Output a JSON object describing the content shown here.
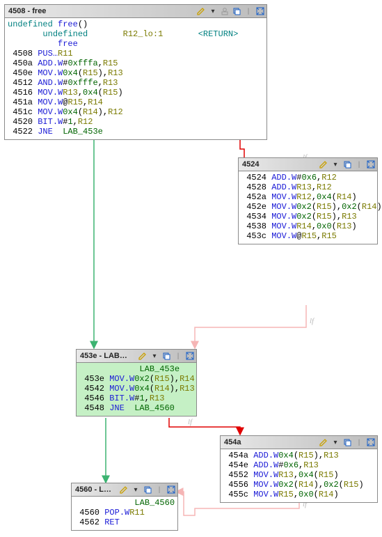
{
  "blocks": {
    "b4508": {
      "title": "4508 - free",
      "sig_line1": {
        "type": "undefined",
        "name": "free",
        "params": "()"
      },
      "sig_line2": {
        "type": "undefined",
        "reg": "R12_lo:1",
        "ret": "<RETURN>"
      },
      "sig_line3": {
        "name": "free"
      },
      "rows": [
        {
          "addr": "4508",
          "mnem": "PUS…",
          "ops": [
            {
              "t": "reg",
              "v": "R11"
            }
          ]
        },
        {
          "addr": "450a",
          "mnem": "ADD.W",
          "ops": [
            {
              "t": "txt",
              "v": "#"
            },
            {
              "t": "num",
              "v": "0xfffa"
            },
            {
              "t": "txt",
              "v": ","
            },
            {
              "t": "reg",
              "v": "R15"
            }
          ]
        },
        {
          "addr": "450e",
          "mnem": "MOV.W",
          "ops": [
            {
              "t": "num",
              "v": "0x4"
            },
            {
              "t": "txt",
              "v": "("
            },
            {
              "t": "reg",
              "v": "R15"
            },
            {
              "t": "txt",
              "v": "),"
            },
            {
              "t": "reg",
              "v": "R13"
            }
          ]
        },
        {
          "addr": "4512",
          "mnem": "AND.W",
          "ops": [
            {
              "t": "txt",
              "v": "#"
            },
            {
              "t": "num",
              "v": "0xfffe"
            },
            {
              "t": "txt",
              "v": ","
            },
            {
              "t": "reg",
              "v": "R13"
            }
          ]
        },
        {
          "addr": "4516",
          "mnem": "MOV.W",
          "ops": [
            {
              "t": "reg",
              "v": "R13"
            },
            {
              "t": "txt",
              "v": ","
            },
            {
              "t": "num",
              "v": "0x4"
            },
            {
              "t": "txt",
              "v": "("
            },
            {
              "t": "reg",
              "v": "R15"
            },
            {
              "t": "txt",
              "v": ")"
            }
          ]
        },
        {
          "addr": "451a",
          "mnem": "MOV.W",
          "ops": [
            {
              "t": "txt",
              "v": "@"
            },
            {
              "t": "reg",
              "v": "R15"
            },
            {
              "t": "txt",
              "v": ","
            },
            {
              "t": "reg",
              "v": "R14"
            }
          ]
        },
        {
          "addr": "451c",
          "mnem": "MOV.W",
          "ops": [
            {
              "t": "num",
              "v": "0x4"
            },
            {
              "t": "txt",
              "v": "("
            },
            {
              "t": "reg",
              "v": "R14"
            },
            {
              "t": "txt",
              "v": "),"
            },
            {
              "t": "reg",
              "v": "R12"
            }
          ]
        },
        {
          "addr": "4520",
          "mnem": "BIT.W",
          "ops": [
            {
              "t": "txt",
              "v": "#"
            },
            {
              "t": "num",
              "v": "1"
            },
            {
              "t": "txt",
              "v": ","
            },
            {
              "t": "reg",
              "v": "R12"
            }
          ]
        },
        {
          "addr": "4522",
          "mnem": "JNE",
          "ops": [
            {
              "t": "txt",
              "v": "  "
            },
            {
              "t": "lbl",
              "v": "LAB_453e"
            }
          ]
        }
      ]
    },
    "b4524": {
      "title": "4524",
      "rows": [
        {
          "addr": "4524",
          "mnem": "ADD.W",
          "ops": [
            {
              "t": "txt",
              "v": "#"
            },
            {
              "t": "num",
              "v": "0x6"
            },
            {
              "t": "txt",
              "v": ","
            },
            {
              "t": "reg",
              "v": "R12"
            }
          ]
        },
        {
          "addr": "4528",
          "mnem": "ADD.W",
          "ops": [
            {
              "t": "reg",
              "v": "R13"
            },
            {
              "t": "txt",
              "v": ","
            },
            {
              "t": "reg",
              "v": "R12"
            }
          ]
        },
        {
          "addr": "452a",
          "mnem": "MOV.W",
          "ops": [
            {
              "t": "reg",
              "v": "R12"
            },
            {
              "t": "txt",
              "v": ","
            },
            {
              "t": "num",
              "v": "0x4"
            },
            {
              "t": "txt",
              "v": "("
            },
            {
              "t": "reg",
              "v": "R14"
            },
            {
              "t": "txt",
              "v": ")"
            }
          ]
        },
        {
          "addr": "452e",
          "mnem": "MOV.W",
          "ops": [
            {
              "t": "num",
              "v": "0x2"
            },
            {
              "t": "txt",
              "v": "("
            },
            {
              "t": "reg",
              "v": "R15"
            },
            {
              "t": "txt",
              "v": "),"
            },
            {
              "t": "num",
              "v": "0x2"
            },
            {
              "t": "txt",
              "v": "("
            },
            {
              "t": "reg",
              "v": "R14"
            },
            {
              "t": "txt",
              "v": ")"
            }
          ]
        },
        {
          "addr": "4534",
          "mnem": "MOV.W",
          "ops": [
            {
              "t": "num",
              "v": "0x2"
            },
            {
              "t": "txt",
              "v": "("
            },
            {
              "t": "reg",
              "v": "R15"
            },
            {
              "t": "txt",
              "v": "),"
            },
            {
              "t": "reg",
              "v": "R13"
            }
          ]
        },
        {
          "addr": "4538",
          "mnem": "MOV.W",
          "ops": [
            {
              "t": "reg",
              "v": "R14"
            },
            {
              "t": "txt",
              "v": ","
            },
            {
              "t": "num",
              "v": "0x0"
            },
            {
              "t": "txt",
              "v": "("
            },
            {
              "t": "reg",
              "v": "R13"
            },
            {
              "t": "txt",
              "v": ")"
            }
          ]
        },
        {
          "addr": "453c",
          "mnem": "MOV.W",
          "ops": [
            {
              "t": "txt",
              "v": "@"
            },
            {
              "t": "reg",
              "v": "R15"
            },
            {
              "t": "txt",
              "v": ","
            },
            {
              "t": "reg",
              "v": "R15"
            }
          ]
        }
      ]
    },
    "b453e": {
      "title": "453e - LAB…",
      "label": "LAB_453e",
      "rows": [
        {
          "addr": "453e",
          "mnem": "MOV.W",
          "ops": [
            {
              "t": "num",
              "v": "0x2"
            },
            {
              "t": "txt",
              "v": "("
            },
            {
              "t": "reg",
              "v": "R15"
            },
            {
              "t": "txt",
              "v": "),"
            },
            {
              "t": "reg",
              "v": "R14"
            }
          ]
        },
        {
          "addr": "4542",
          "mnem": "MOV.W",
          "ops": [
            {
              "t": "num",
              "v": "0x4"
            },
            {
              "t": "txt",
              "v": "("
            },
            {
              "t": "reg",
              "v": "R14"
            },
            {
              "t": "txt",
              "v": "),"
            },
            {
              "t": "reg",
              "v": "R13"
            }
          ]
        },
        {
          "addr": "4546",
          "mnem": "BIT.W",
          "ops": [
            {
              "t": "txt",
              "v": "#"
            },
            {
              "t": "num",
              "v": "1"
            },
            {
              "t": "txt",
              "v": ","
            },
            {
              "t": "reg",
              "v": "R13"
            }
          ]
        },
        {
          "addr": "4548",
          "mnem": "JNE",
          "ops": [
            {
              "t": "txt",
              "v": "  "
            },
            {
              "t": "lbl",
              "v": "LAB_4560"
            }
          ]
        }
      ]
    },
    "b454a": {
      "title": "454a",
      "rows": [
        {
          "addr": "454a",
          "mnem": "ADD.W",
          "ops": [
            {
              "t": "num",
              "v": "0x4"
            },
            {
              "t": "txt",
              "v": "("
            },
            {
              "t": "reg",
              "v": "R15"
            },
            {
              "t": "txt",
              "v": "),"
            },
            {
              "t": "reg",
              "v": "R13"
            }
          ]
        },
        {
          "addr": "454e",
          "mnem": "ADD.W",
          "ops": [
            {
              "t": "txt",
              "v": "#"
            },
            {
              "t": "num",
              "v": "0x6"
            },
            {
              "t": "txt",
              "v": ","
            },
            {
              "t": "reg",
              "v": "R13"
            }
          ]
        },
        {
          "addr": "4552",
          "mnem": "MOV.W",
          "ops": [
            {
              "t": "reg",
              "v": "R13"
            },
            {
              "t": "txt",
              "v": ","
            },
            {
              "t": "num",
              "v": "0x4"
            },
            {
              "t": "txt",
              "v": "("
            },
            {
              "t": "reg",
              "v": "R15"
            },
            {
              "t": "txt",
              "v": ")"
            }
          ]
        },
        {
          "addr": "4556",
          "mnem": "MOV.W",
          "ops": [
            {
              "t": "num",
              "v": "0x2"
            },
            {
              "t": "txt",
              "v": "("
            },
            {
              "t": "reg",
              "v": "R14"
            },
            {
              "t": "txt",
              "v": "),"
            },
            {
              "t": "num",
              "v": "0x2"
            },
            {
              "t": "txt",
              "v": "("
            },
            {
              "t": "reg",
              "v": "R15"
            },
            {
              "t": "txt",
              "v": ")"
            }
          ]
        },
        {
          "addr": "455c",
          "mnem": "MOV.W",
          "ops": [
            {
              "t": "reg",
              "v": "R15"
            },
            {
              "t": "txt",
              "v": ","
            },
            {
              "t": "num",
              "v": "0x0"
            },
            {
              "t": "txt",
              "v": "("
            },
            {
              "t": "reg",
              "v": "R14"
            },
            {
              "t": "txt",
              "v": ")"
            }
          ]
        }
      ]
    },
    "b4560": {
      "title": "4560 - L…",
      "label": "LAB_4560",
      "rows": [
        {
          "addr": "4560",
          "mnem": "POP.W",
          "ops": [
            {
              "t": "reg",
              "v": "R11"
            }
          ]
        },
        {
          "addr": "4562",
          "mnem": "RET",
          "ops": []
        }
      ]
    }
  },
  "edge_labels": {
    "lf1": "lf",
    "lf2": "lf",
    "lf3": "lf",
    "lf4": "lf"
  }
}
